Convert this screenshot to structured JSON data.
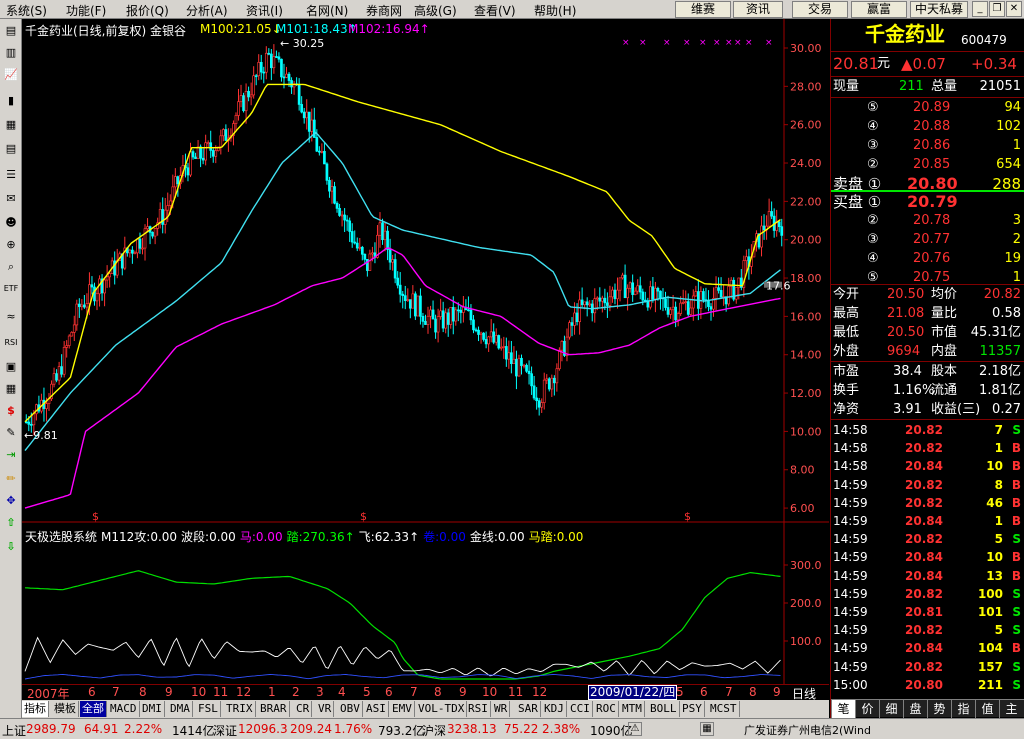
{
  "menu": [
    "系统(S)",
    "功能(F)",
    "报价(Q)",
    "分析(A)",
    "资讯(I)",
    "名网(N)",
    "券商网",
    "高级(G)",
    "查看(V)",
    "帮助(H)"
  ],
  "top_buttons": [
    "维赛",
    "资讯",
    "交易",
    "赢富",
    "中天私募"
  ],
  "chart_header": {
    "title": "千金药业(日线,前复权) 金银谷",
    "ma100": "M100:21.05↓",
    "ma101": "M101:18.43↑",
    "ma102": "M102:16.94↑"
  },
  "price_axis": [
    "30.00",
    "28.00",
    "26.00",
    "24.00",
    "22.00",
    "20.00",
    "18.00",
    "16.00",
    "14.00",
    "12.00",
    "10.00",
    "8.00",
    "6.00"
  ],
  "ind_axis": [
    "300.0",
    "200.0",
    "100.0"
  ],
  "annotations": {
    "high": "30.25",
    "low": "9.81",
    "last": "17.6"
  },
  "indicator_header": [
    {
      "text": "天极选股系统",
      "color": "#ffffff"
    },
    {
      "text": "M112攻:0.00",
      "color": "#ffffff"
    },
    {
      "text": "波段:0.00",
      "color": "#ffffff"
    },
    {
      "text": "马:0.00",
      "color": "#ff00ff"
    },
    {
      "text": "踏:270.36↑",
      "color": "#00ff00"
    },
    {
      "text": "飞:62.33↑",
      "color": "#ffffff"
    },
    {
      "text": "卷:0.00",
      "color": "#0000ff"
    },
    {
      "text": "金线:0.00",
      "color": "#ffffff"
    },
    {
      "text": "马踏:0.00",
      "color": "#ffff00"
    }
  ],
  "time_axis": {
    "labels": [
      "2007年",
      "6",
      "7",
      "8",
      "9",
      "10",
      "11",
      "12",
      "1",
      "2",
      "3",
      "4",
      "5",
      "6",
      "7",
      "8",
      "9",
      "10",
      "11",
      "12",
      "1",
      "2",
      "3",
      "4",
      "5",
      "6",
      "7",
      "8",
      "9"
    ],
    "date_box": "2009/01/22/四",
    "period": "日线"
  },
  "tabs": [
    "指标",
    "模板",
    "全部",
    "MACD",
    "DMI",
    "DMA",
    "FSL",
    "TRIX",
    "BRAR",
    "CR",
    "VR",
    "OBV",
    "ASI",
    "EMV",
    "VOL-TDX",
    "RSI",
    "WR",
    "SAR",
    "KDJ",
    "CCI",
    "ROC",
    "MTM",
    "BOLL",
    "PSY",
    "MCST"
  ],
  "stock": {
    "name": "千金药业",
    "code": "600479",
    "price": "20.81",
    "unit": "元",
    "change": "▲0.07",
    "pct": "+0.34"
  },
  "vol_row": {
    "l1": "现量",
    "v1": "211",
    "l2": "总量",
    "v2": "21051"
  },
  "asks": [
    {
      "lvl": "⑤",
      "price": "20.89",
      "vol": "94"
    },
    {
      "lvl": "④",
      "price": "20.88",
      "vol": "102"
    },
    {
      "lvl": "③",
      "price": "20.86",
      "vol": "1"
    },
    {
      "lvl": "②",
      "price": "20.85",
      "vol": "654"
    },
    {
      "lvl": "卖盘 ①",
      "price": "20.80",
      "vol": "288"
    }
  ],
  "bids": [
    {
      "lvl": "买盘 ①",
      "price": "20.79",
      "vol": ""
    },
    {
      "lvl": "②",
      "price": "20.78",
      "vol": "3"
    },
    {
      "lvl": "③",
      "price": "20.77",
      "vol": "2"
    },
    {
      "lvl": "④",
      "price": "20.76",
      "vol": "19"
    },
    {
      "lvl": "⑤",
      "price": "20.75",
      "vol": "1"
    }
  ],
  "stats": [
    {
      "l1": "今开",
      "v1": "20.50",
      "l2": "均价",
      "v2": "20.82",
      "c1": "#ff3232",
      "c2": "#ff3232"
    },
    {
      "l1": "最高",
      "v1": "21.08",
      "l2": "量比",
      "v2": "0.58",
      "c1": "#ff3232",
      "c2": "#ffffff"
    },
    {
      "l1": "最低",
      "v1": "20.50",
      "l2": "市值",
      "v2": "45.31亿",
      "c1": "#ff3232",
      "c2": "#ffffff"
    },
    {
      "l1": "外盘",
      "v1": "9694",
      "l2": "内盘",
      "v2": "11357",
      "c1": "#ff3232",
      "c2": "#00e600"
    }
  ],
  "fund": [
    {
      "l1": "市盈",
      "v1": "38.4",
      "l2": "股本",
      "v2": "2.18亿"
    },
    {
      "l1": "换手",
      "v1": "1.16%",
      "l2": "流通",
      "v2": "1.81亿"
    },
    {
      "l1": "净资",
      "v1": "3.91",
      "l2": "收益(三)",
      "v2": "0.27"
    }
  ],
  "ticks": [
    {
      "t": "14:58",
      "p": "20.82",
      "v": "7",
      "s": "S"
    },
    {
      "t": "14:58",
      "p": "20.82",
      "v": "1",
      "s": "B"
    },
    {
      "t": "14:58",
      "p": "20.84",
      "v": "10",
      "s": "B"
    },
    {
      "t": "14:59",
      "p": "20.82",
      "v": "8",
      "s": "B"
    },
    {
      "t": "14:59",
      "p": "20.82",
      "v": "46",
      "s": "B"
    },
    {
      "t": "14:59",
      "p": "20.84",
      "v": "1",
      "s": "B"
    },
    {
      "t": "14:59",
      "p": "20.82",
      "v": "5",
      "s": "S"
    },
    {
      "t": "14:59",
      "p": "20.84",
      "v": "10",
      "s": "B"
    },
    {
      "t": "14:59",
      "p": "20.84",
      "v": "13",
      "s": "B"
    },
    {
      "t": "14:59",
      "p": "20.82",
      "v": "100",
      "s": "S"
    },
    {
      "t": "14:59",
      "p": "20.81",
      "v": "101",
      "s": "S"
    },
    {
      "t": "14:59",
      "p": "20.82",
      "v": "5",
      "s": "S"
    },
    {
      "t": "14:59",
      "p": "20.84",
      "v": "104",
      "s": "B"
    },
    {
      "t": "14:59",
      "p": "20.82",
      "v": "157",
      "s": "S"
    },
    {
      "t": "15:00",
      "p": "20.80",
      "v": "211",
      "s": "S"
    }
  ],
  "panel_tabs": [
    "笔",
    "价",
    "细",
    "盘",
    "势",
    "指",
    "值",
    "主"
  ],
  "status": {
    "sh_label": "上证",
    "sh_val": "2989.79",
    "sh_chg": "64.91",
    "sh_pct": "2.22%",
    "sh_amt": "1414亿",
    "sz_label": "深证",
    "sz_val": "12096.3",
    "sz_chg": "209.24",
    "sz_pct": "1.76%",
    "sz_amt": "793.2亿",
    "hs_label": "沪深",
    "hs_val": "3238.13",
    "hs_chg": "75.22",
    "hs_pct": "2.38%",
    "hs_amt": "1090亿",
    "broker": "广发证券广州电信2(Wind"
  },
  "colors": {
    "up": "#ff3232",
    "down": "#00ffff",
    "ma100": "#ffff00",
    "ma101": "#40e0f0",
    "ma102": "#ff00ff"
  }
}
